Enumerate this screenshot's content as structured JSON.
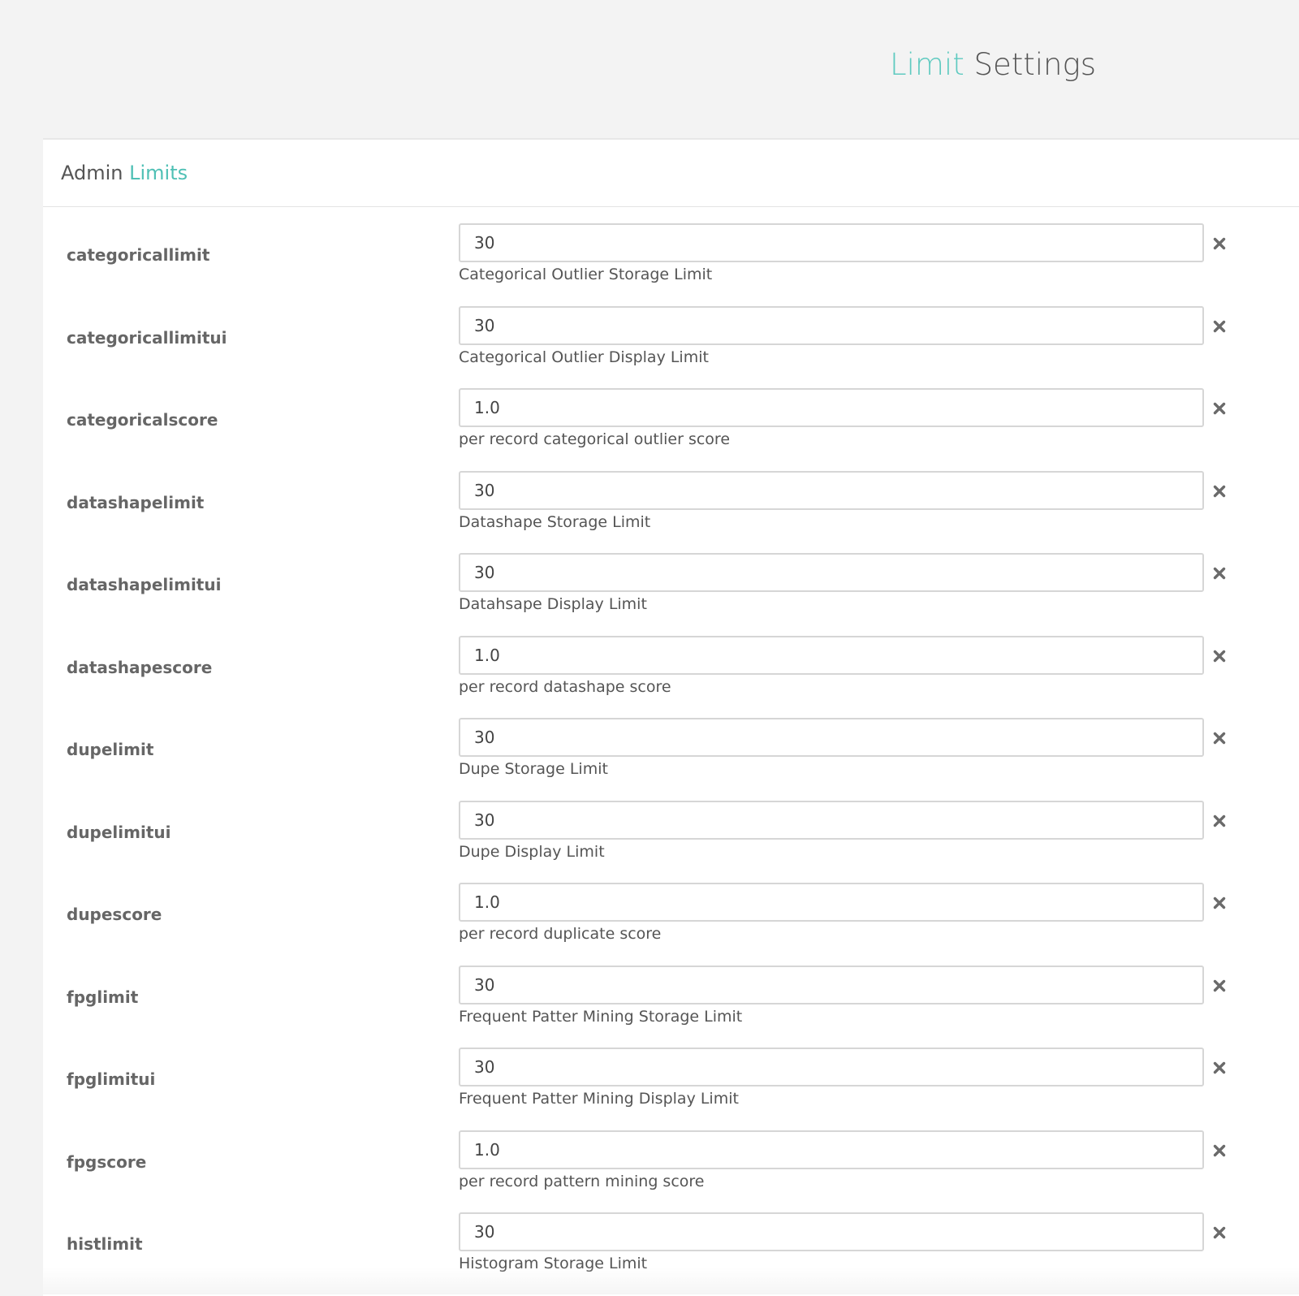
{
  "header": {
    "title_accent": "Limit",
    "title_rest": "Settings"
  },
  "panel": {
    "title_plain": "Admin",
    "title_accent": "Limits"
  },
  "icons": {
    "remove": "close-icon"
  },
  "colors": {
    "accent": "#5fcac0",
    "text": "#555555",
    "background": "#f3f3f3"
  },
  "rows": [
    {
      "key": "categoricallimit",
      "value": "30",
      "help": "Categorical Outlier Storage Limit"
    },
    {
      "key": "categoricallimitui",
      "value": "30",
      "help": "Categorical Outlier Display Limit"
    },
    {
      "key": "categoricalscore",
      "value": "1.0",
      "help": "per record categorical outlier score"
    },
    {
      "key": "datashapelimit",
      "value": "30",
      "help": "Datashape Storage Limit"
    },
    {
      "key": "datashapelimitui",
      "value": "30",
      "help": "Datahsape Display Limit"
    },
    {
      "key": "datashapescore",
      "value": "1.0",
      "help": "per record datashape score"
    },
    {
      "key": "dupelimit",
      "value": "30",
      "help": "Dupe Storage Limit"
    },
    {
      "key": "dupelimitui",
      "value": "30",
      "help": "Dupe Display Limit"
    },
    {
      "key": "dupescore",
      "value": "1.0",
      "help": "per record duplicate score"
    },
    {
      "key": "fpglimit",
      "value": "30",
      "help": "Frequent Patter Mining Storage Limit"
    },
    {
      "key": "fpglimitui",
      "value": "30",
      "help": "Frequent Patter Mining Display Limit"
    },
    {
      "key": "fpgscore",
      "value": "1.0",
      "help": "per record pattern mining score"
    },
    {
      "key": "histlimit",
      "value": "30",
      "help": "Histogram Storage Limit"
    }
  ]
}
